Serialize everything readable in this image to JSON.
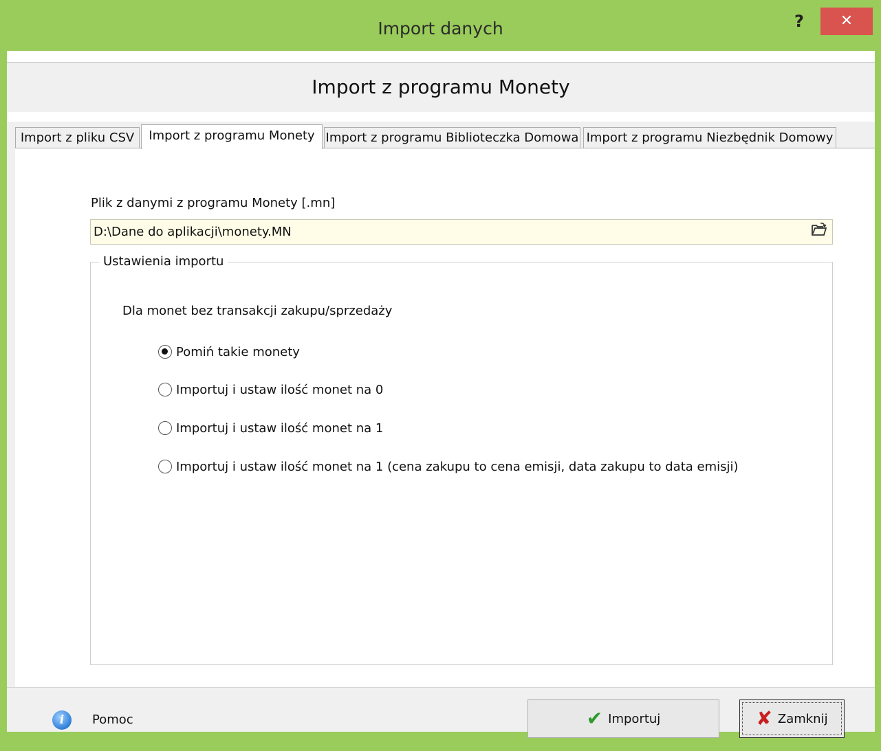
{
  "window": {
    "title": "Import danych",
    "help_label": "?",
    "close_label": "✕"
  },
  "header": {
    "title": "Import z programu Monety"
  },
  "tabs": [
    {
      "label": "Import z pliku CSV",
      "active": false
    },
    {
      "label": "Import z programu Monety",
      "active": true
    },
    {
      "label": "Import z programu Biblioteczka Domowa",
      "active": false
    },
    {
      "label": "Import z programu Niezbędnik Domowy",
      "active": false
    }
  ],
  "file": {
    "label": "Plik z danymi z programu Monety [.mn]",
    "value": "D:\\Dane do aplikacji\\monety.MN",
    "browse_icon": "open-folder-icon"
  },
  "settings": {
    "legend": "Ustawienia importu",
    "question": "Dla monet bez transakcji zakupu/sprzedaży",
    "options": [
      {
        "label": "Pomiń takie monety",
        "checked": true
      },
      {
        "label": "Importuj i ustaw ilość monet na 0",
        "checked": false
      },
      {
        "label": "Importuj i ustaw ilość monet na 1",
        "checked": false
      },
      {
        "label": "Importuj i ustaw ilość monet na 1 (cena zakupu to cena emisji,  data zakupu to data emisji)",
        "checked": false
      }
    ]
  },
  "footer": {
    "help_label": "Pomoc",
    "import_label": "Importuj",
    "close_label": "Zamknij"
  },
  "colors": {
    "titlebar": "#99cc5a",
    "close_button": "#d9534f",
    "input_background": "#fffde7"
  }
}
